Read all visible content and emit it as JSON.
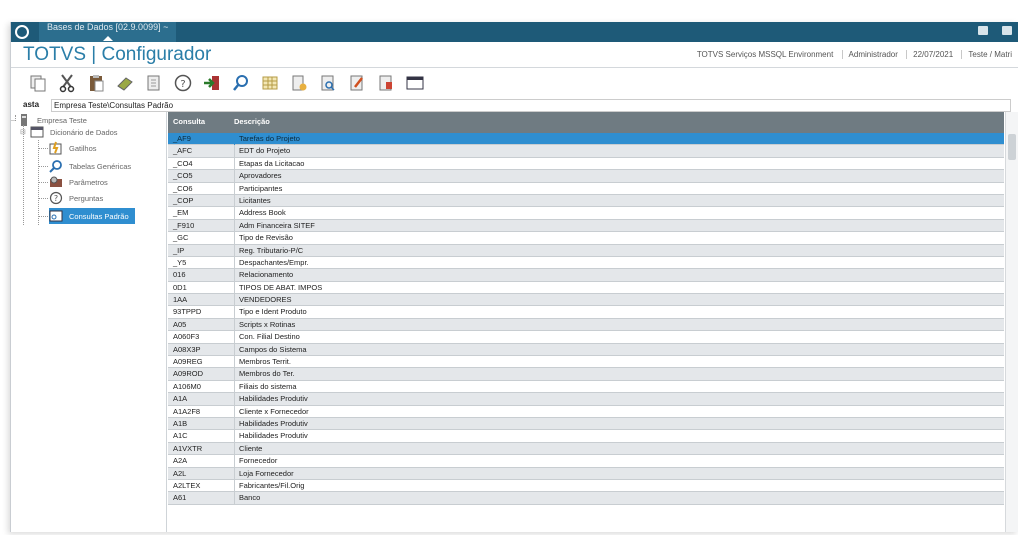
{
  "topbar": {
    "db_label": "Bases de Dados [02.9.0099] ~"
  },
  "header": {
    "title": "TOTVS | Configurador",
    "environment": "TOTVS Serviços MSSQL Environment",
    "user": "Administrador",
    "date": "22/07/2021",
    "company": "Teste / Matri"
  },
  "toolbar": {
    "icons": [
      "copy-icon",
      "cut-icon",
      "paste-icon",
      "eraser-icon",
      "document-icon",
      "help-icon",
      "exit-icon",
      "search-icon",
      "grid-icon",
      "export-icon",
      "preview-icon",
      "edit-icon",
      "report-icon",
      "window-icon"
    ]
  },
  "breadcrumb": {
    "label": "asta",
    "path": "Empresa Teste\\Consultas Padrão"
  },
  "tree": {
    "root": "Empresa Teste",
    "items": [
      {
        "label": "Dicionário de Dados",
        "icon": "table-icon"
      },
      {
        "label": "Gatilhos",
        "icon": "trigger-icon"
      },
      {
        "label": "Tabelas Genéricas",
        "icon": "search-icon"
      },
      {
        "label": "Parâmetros",
        "icon": "parameters-icon"
      },
      {
        "label": "Perguntas",
        "icon": "question-icon"
      },
      {
        "label": "Consultas Padrão",
        "icon": "query-icon"
      }
    ]
  },
  "grid": {
    "columns": [
      "Consulta",
      "Descrição"
    ],
    "rows": [
      [
        "_AF9",
        "Tarefas do Projeto"
      ],
      [
        "_AFC",
        "EDT do Projeto"
      ],
      [
        "_CO4",
        "Etapas da Licitacao"
      ],
      [
        "_CO5",
        "Aprovadores"
      ],
      [
        "_CO6",
        "Participantes"
      ],
      [
        "_COP",
        "Licitantes"
      ],
      [
        "_EM",
        "Address Book"
      ],
      [
        "_F910",
        "Adm Financeira SITEF"
      ],
      [
        "_GC",
        "Tipo de Revisão"
      ],
      [
        "_IP",
        "Reg. Tributario-P/C"
      ],
      [
        "_Y5",
        "Despachantes/Empr."
      ],
      [
        "016",
        "Relacionamento"
      ],
      [
        "0D1",
        "TIPOS DE ABAT. IMPOS"
      ],
      [
        "1AA",
        "VENDEDORES"
      ],
      [
        "93TPPD",
        "Tipo e Ident Produto"
      ],
      [
        "A05",
        "Scripts x Rotinas"
      ],
      [
        "A060F3",
        "Con. Filial Destino"
      ],
      [
        "A08X3P",
        "Campos do Sistema"
      ],
      [
        "A09REG",
        "Membros Territ."
      ],
      [
        "A09ROD",
        "Membros do Ter."
      ],
      [
        "A106M0",
        "Filiais do sistema"
      ],
      [
        "A1A",
        "Habilidades Produtiv"
      ],
      [
        "A1A2F8",
        "Cliente x Fornecedor"
      ],
      [
        "A1B",
        "Habilidades Produtiv"
      ],
      [
        "A1C",
        "Habilidades Produtiv"
      ],
      [
        "A1VXTR",
        "Cliente"
      ],
      [
        "A2A",
        "Fornecedor"
      ],
      [
        "A2L",
        "Loja Fornecedor"
      ],
      [
        "A2LTEX",
        "Fabricantes/Fil.Orig"
      ],
      [
        "A61",
        "Banco"
      ]
    ],
    "selected_index": 0
  }
}
